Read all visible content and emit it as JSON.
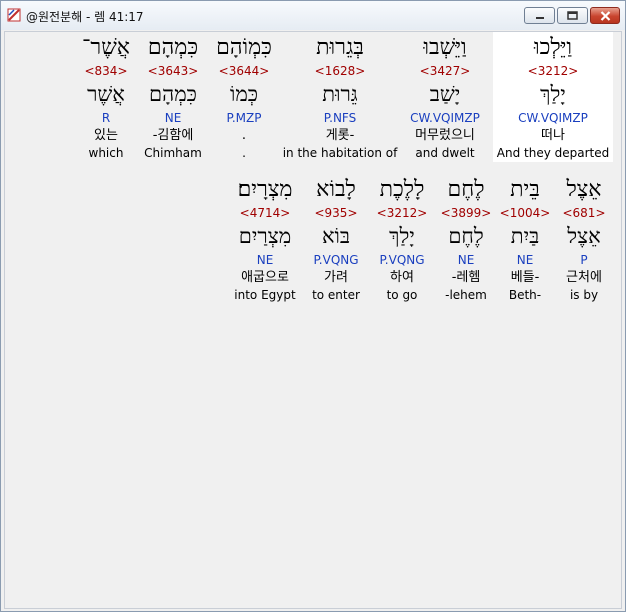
{
  "window": {
    "title": "@원전분해 - 렘 41:17"
  },
  "lines": [
    {
      "words": [
        {
          "hebrew": "וַיֵּלְכוּ",
          "strong": "<3212>",
          "lemma": "יָלַךְ",
          "parse": "CW.VQIMZP",
          "korean": "떠나",
          "english": "And they departed",
          "selected": true
        },
        {
          "hebrew": "וַיֵּשְׁבוּ",
          "strong": "<3427>",
          "lemma": "יָשַׁב",
          "parse": "CW.VQIMZP",
          "korean": "머무렀으니",
          "english": "and dwelt",
          "selected": false
        },
        {
          "hebrew": "בְּגֵרוּת",
          "strong": "<1628>",
          "lemma": "גֵּרוּת",
          "parse": "P.NFS",
          "korean": "게롯-",
          "english": "in the habitation of",
          "selected": false
        },
        {
          "hebrew": "כִּמְוֹהָם",
          "strong": "<3644>",
          "lemma": "כְּמוֹ",
          "parse": "P.MZP",
          "korean": ".",
          "english": ".",
          "selected": false
        },
        {
          "hebrew": "כִּמְהָם",
          "strong": "<3643>",
          "lemma": "כִּמְהָם",
          "parse": "NE",
          "korean": "-김함에",
          "english": "Chimham",
          "selected": false
        },
        {
          "hebrew": "אֲשֶׁר־",
          "strong": "<834>",
          "lemma": "אֲשֶׁר",
          "parse": "R",
          "korean": "있는",
          "english": "which",
          "selected": false
        }
      ]
    },
    {
      "words": [
        {
          "hebrew": "אֵצֶל",
          "strong": "<681>",
          "lemma": "אֵצֶל",
          "parse": "P",
          "korean": "근처에",
          "english": "is by",
          "selected": false
        },
        {
          "hebrew": "בֵּית",
          "strong": "<1004>",
          "lemma": "בַּיִת",
          "parse": "NE",
          "korean": "베들-",
          "english": "Beth-",
          "selected": false
        },
        {
          "hebrew": "לֶחֶם",
          "strong": "<3899>",
          "lemma": "לֶחֶם",
          "parse": "NE",
          "korean": "-레헴",
          "english": "-lehem",
          "selected": false
        },
        {
          "hebrew": "לָלֶכֶת",
          "strong": "<3212>",
          "lemma": "יָלַךְ",
          "parse": "P.VQNG",
          "korean": "하여",
          "english": "to go",
          "selected": false
        },
        {
          "hebrew": "לָבוֹא",
          "strong": "<935>",
          "lemma": "בּוֹא",
          "parse": "P.VQNG",
          "korean": "가려",
          "english": "to enter",
          "selected": false
        },
        {
          "hebrew": "מִצְרָיִם׃",
          "strong": "<4714>",
          "lemma": "מִצְרַיִם",
          "parse": "NE",
          "korean": "애굽으로",
          "english": "into Egypt",
          "selected": false
        }
      ]
    }
  ],
  "colors": {
    "strong": "#a00000",
    "parse": "#1a3fbf",
    "selected_background": "#ffffff"
  }
}
